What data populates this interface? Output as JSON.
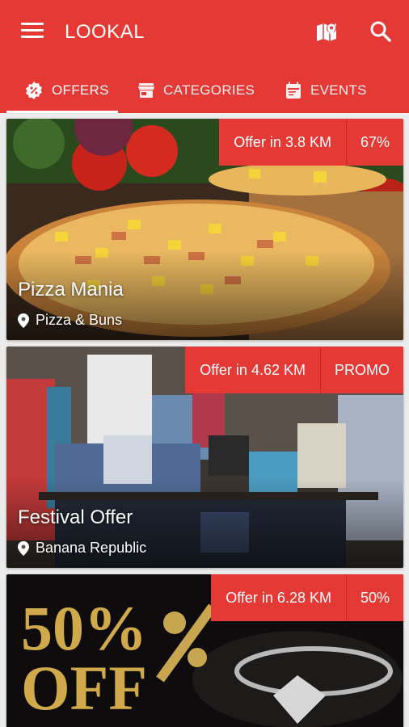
{
  "app": {
    "title": "LOOKAL"
  },
  "tabs": [
    {
      "label": "OFFERS",
      "icon": "badge-percent-icon"
    },
    {
      "label": "CATEGORIES",
      "icon": "store-icon"
    },
    {
      "label": "EVENTS",
      "icon": "calendar-icon"
    }
  ],
  "offers": [
    {
      "title": "Pizza Mania",
      "location": "Pizza & Buns",
      "distance": "Offer in 3.8 KM",
      "discount": "67%"
    },
    {
      "title": "Festival Offer",
      "location": "Banana Republic",
      "distance": "Offer in 4.62 KM",
      "discount": "PROMO"
    },
    {
      "title": "",
      "location": "",
      "distance": "Offer in 6.28 KM",
      "discount": "50%",
      "image_text": "50% OFF"
    }
  ],
  "colors": {
    "primary": "#e53935",
    "accent_text": "#ffffff"
  }
}
